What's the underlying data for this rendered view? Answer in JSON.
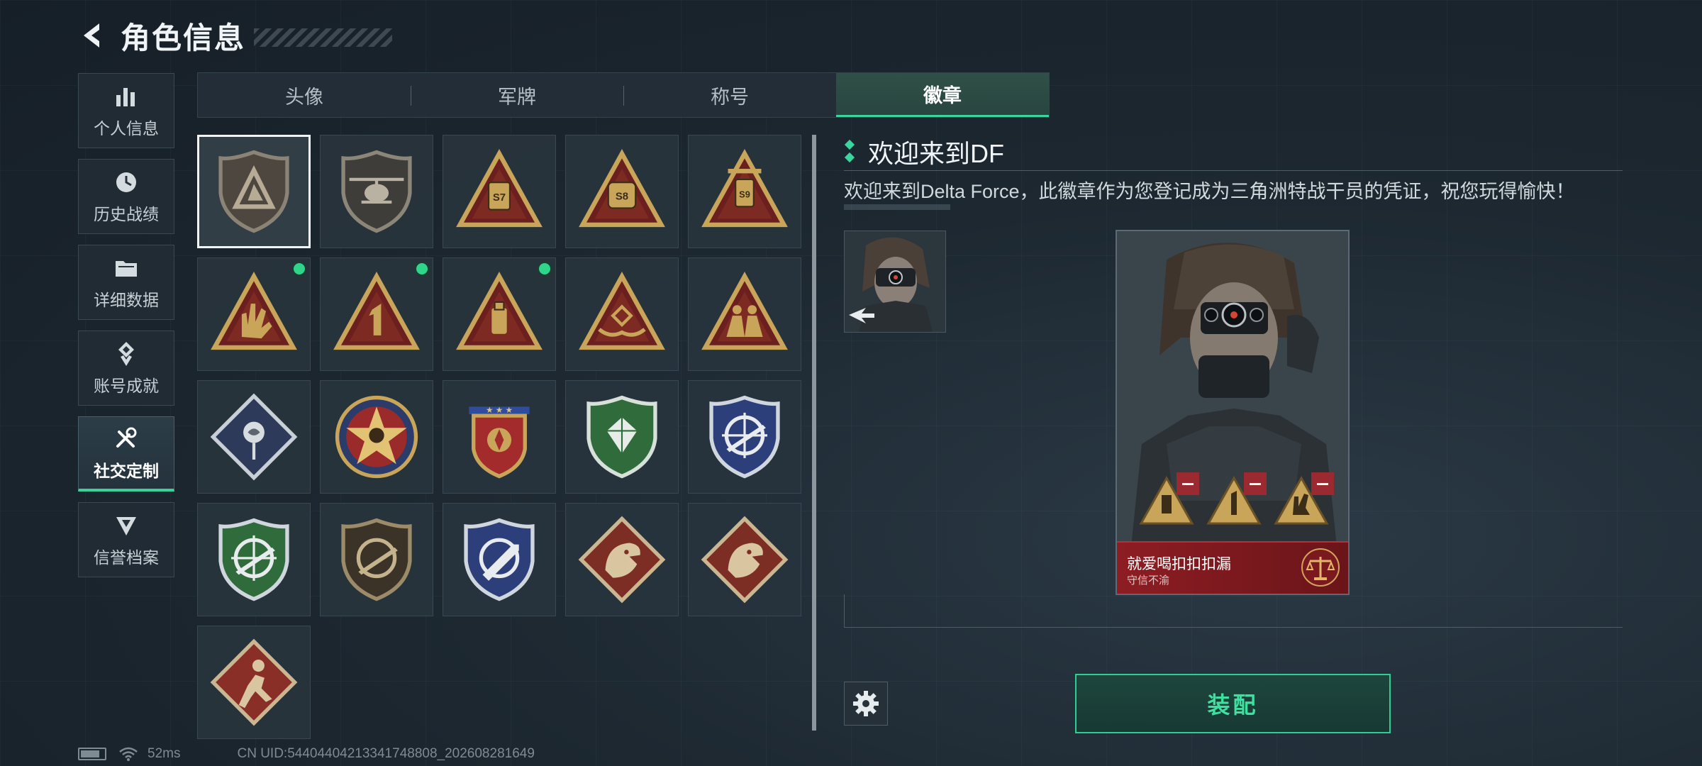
{
  "header": {
    "title": "角色信息"
  },
  "nav": [
    {
      "label": "个人信息",
      "icon": "bar-chart-icon",
      "active": false
    },
    {
      "label": "历史战绩",
      "icon": "history-clock-icon",
      "active": false
    },
    {
      "label": "详细数据",
      "icon": "folder-icon",
      "active": false
    },
    {
      "label": "账号成就",
      "icon": "achievement-icon",
      "active": false
    },
    {
      "label": "社交定制",
      "icon": "wrench-screwdriver-icon",
      "active": true
    },
    {
      "label": "信誉档案",
      "icon": "credit-shield-icon",
      "active": false
    }
  ],
  "tabs": [
    {
      "label": "头像",
      "active": false
    },
    {
      "label": "军牌",
      "active": false
    },
    {
      "label": "称号",
      "active": false
    },
    {
      "label": "徽章",
      "active": true
    }
  ],
  "badges": [
    {
      "name": "delta-shield-badge",
      "selected": true,
      "new": false
    },
    {
      "name": "helicopter-shield-badge",
      "selected": false,
      "new": false
    },
    {
      "name": "s7-triangle-badge",
      "label": "S7",
      "selected": false,
      "new": false
    },
    {
      "name": "s8-triangle-badge",
      "label": "S8",
      "selected": false,
      "new": false
    },
    {
      "name": "s9-triangle-badge",
      "label": "S9",
      "selected": false,
      "new": false
    },
    {
      "name": "hand-sign-triangle-badge",
      "selected": false,
      "new": true
    },
    {
      "name": "number-one-triangle-badge",
      "label": "1",
      "selected": false,
      "new": true
    },
    {
      "name": "usb-triangle-badge",
      "selected": false,
      "new": true
    },
    {
      "name": "hands-triangle-badge",
      "selected": false,
      "new": false
    },
    {
      "name": "squad-triangle-badge",
      "selected": false,
      "new": false
    },
    {
      "name": "rose-diamond-badge",
      "selected": false,
      "new": false
    },
    {
      "name": "star-emblem-badge",
      "selected": false,
      "new": false
    },
    {
      "name": "three-star-crest-badge",
      "selected": false,
      "new": false
    },
    {
      "name": "green-gem-shield-badge",
      "selected": false,
      "new": false
    },
    {
      "name": "blue-rifle-shield-badge",
      "selected": false,
      "new": false
    },
    {
      "name": "green-rifle-shield-badge",
      "selected": false,
      "new": false
    },
    {
      "name": "brown-rifle-shield-badge",
      "selected": false,
      "new": false
    },
    {
      "name": "blue-knife-shield-badge",
      "selected": false,
      "new": false
    },
    {
      "name": "dragon-diamond-badge",
      "selected": false,
      "new": false
    },
    {
      "name": "dragon-diamond-badge-2",
      "selected": false,
      "new": false
    },
    {
      "name": "runner-diamond-badge",
      "selected": false,
      "new": false
    }
  ],
  "detail": {
    "badge_name": "欢迎来到DF",
    "description": "欢迎来到Delta Force，此徽章作为您登记成为三角洲特战干员的凭证，祝您玩得愉快！"
  },
  "card": {
    "player_name": "就爱喝扣扣扣漏",
    "subtitle": "守信不渝"
  },
  "actions": {
    "equip_label": "装配"
  },
  "status": {
    "ping": "52ms",
    "uid": "CN UID:54404404213341748808_202608281649"
  },
  "colors": {
    "accent": "#38d39b",
    "card_red": "#8d1d23",
    "badge_gold": "#c9a55a"
  }
}
